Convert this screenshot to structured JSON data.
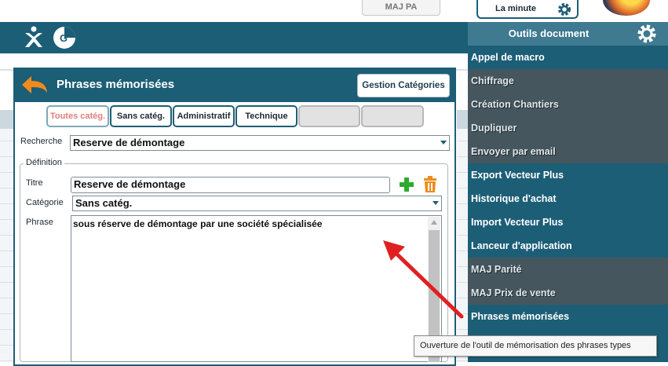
{
  "top": {
    "maj_pa_label": "MAJ PA",
    "la_minute_label": "La minute"
  },
  "toolbar": {
    "icons": [
      "accessibility-icon",
      "google-analytics-icon"
    ]
  },
  "dialog": {
    "title": "Phrases mémorisées",
    "gestion_label": "Gestion Catégories",
    "tabs": [
      {
        "label": "Toutes catég."
      },
      {
        "label": "Sans catég."
      },
      {
        "label": "Administratif"
      },
      {
        "label": "Technique"
      },
      {
        "label": ""
      },
      {
        "label": ""
      }
    ],
    "recherche_label": "Recherche",
    "recherche_value": "Reserve de démontage",
    "definition_legend": "Définition",
    "titre_label": "Titre",
    "titre_value": "Reserve de démontage",
    "categorie_label": "Catégorie",
    "categorie_value": "Sans catég.",
    "phrase_label": "Phrase",
    "phrase_value": "sous réserve de démontage par une société spécialisée"
  },
  "menu": {
    "title": "Outils document",
    "items": [
      {
        "label": "Appel de macro",
        "style": "t"
      },
      {
        "label": "Chiffrage",
        "style": "g"
      },
      {
        "label": "Création Chantiers",
        "style": "g"
      },
      {
        "label": "Dupliquer",
        "style": "g"
      },
      {
        "label": "Envoyer par email",
        "style": "g"
      },
      {
        "label": "Export Vecteur Plus",
        "style": "t"
      },
      {
        "label": "Historique d'achat",
        "style": "t"
      },
      {
        "label": "Import Vecteur Plus",
        "style": "t"
      },
      {
        "label": "Lanceur d'application",
        "style": "t"
      },
      {
        "label": "MAJ Parité",
        "style": "g"
      },
      {
        "label": "MAJ Prix de vente",
        "style": "g"
      },
      {
        "label": "Phrases mémorisées",
        "style": "t"
      }
    ]
  },
  "tooltip": {
    "text": "Ouverture de l'outil de mémorisation des phrases types"
  },
  "colors": {
    "teal": "#1d5e77",
    "menu_gray": "#46565e",
    "accent_orange": "#f08a1c",
    "add_green": "#2eaa2e",
    "arrow_red": "#e02020"
  }
}
